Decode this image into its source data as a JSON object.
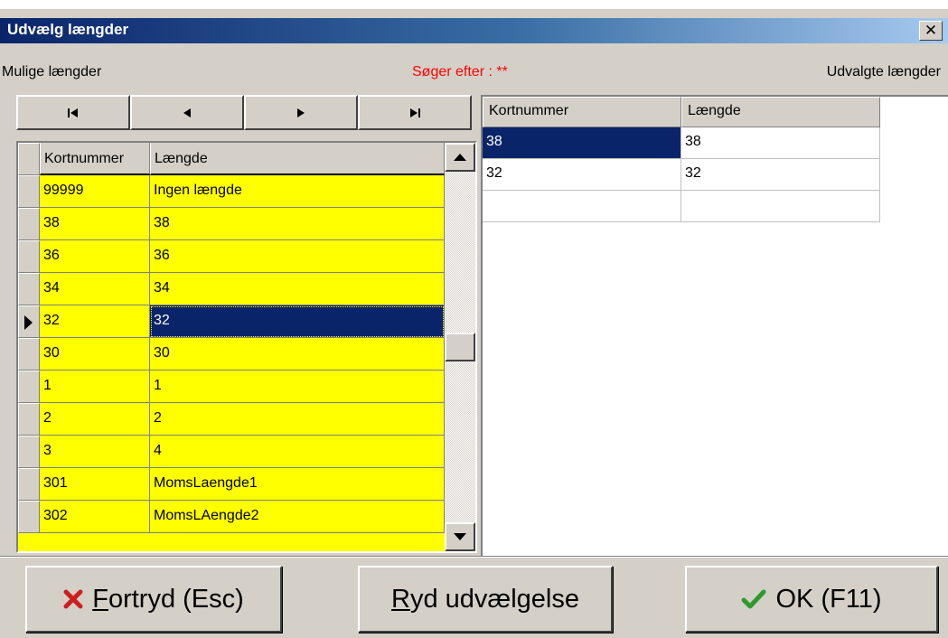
{
  "window": {
    "title": "Udvælg længder",
    "close_glyph": "✕"
  },
  "infobar": {
    "left_label": "Mulige længder",
    "search_label": "Søger efter : **",
    "right_label": "Udvalgte længder",
    "search_color": "#ff0000"
  },
  "navigator": {
    "buttons": [
      "first-record-icon",
      "prior-record-icon",
      "next-record-icon",
      "last-record-icon"
    ]
  },
  "left_grid": {
    "columns": [
      "Kortnummer",
      "Længde"
    ],
    "rows": [
      {
        "nr": "99999",
        "len": "Ingen længde"
      },
      {
        "nr": "38",
        "len": "38"
      },
      {
        "nr": "36",
        "len": "36"
      },
      {
        "nr": "34",
        "len": "34"
      },
      {
        "nr": "32",
        "len": "32"
      },
      {
        "nr": "30",
        "len": "30"
      },
      {
        "nr": "1",
        "len": "1"
      },
      {
        "nr": "2",
        "len": "2"
      },
      {
        "nr": "3",
        "len": "4"
      },
      {
        "nr": "301",
        "len": "MomsLaengde1"
      },
      {
        "nr": "302",
        "len": "MomsLAengde2"
      }
    ],
    "current_row_index": 4,
    "background_color": "#ffff00"
  },
  "right_grid": {
    "columns": [
      "Kortnummer",
      "Længde"
    ],
    "rows": [
      {
        "nr": "38",
        "len": "38"
      },
      {
        "nr": "32",
        "len": "32"
      },
      {
        "nr": "",
        "len": ""
      }
    ],
    "selected_row_index": 0
  },
  "buttons": {
    "cancel": {
      "mnemonic": "F",
      "rest": "ortryd (Esc)",
      "icon": "red-x-icon"
    },
    "clear": {
      "mnemonic": "R",
      "rest": "yd udvælgelse"
    },
    "ok": {
      "label": "OK (F11)",
      "icon": "green-check-icon"
    }
  },
  "colors": {
    "title_gradient_start": "#0a246a",
    "selection": "#0a246a",
    "face": "#d4d0c8"
  }
}
